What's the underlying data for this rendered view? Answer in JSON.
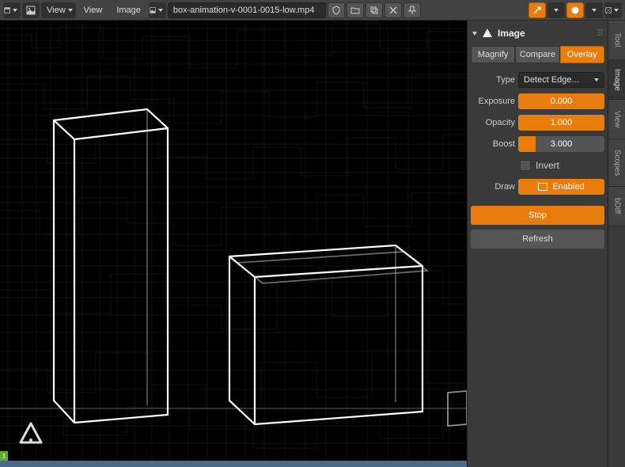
{
  "toolbar": {
    "view_menu_label": "View",
    "view_label": "View",
    "image_label": "Image",
    "file_name": "box-animation-v-0001-0015-low.mp4"
  },
  "panel": {
    "title": "Image",
    "tabs": {
      "magnify": "Magnify",
      "compare": "Compare",
      "overlay": "Overlay"
    },
    "props": {
      "type_label": "Type",
      "type_value": "Detect Edge...",
      "exposure_label": "Exposure",
      "exposure_value": "0.000",
      "opacity_label": "Opacity",
      "opacity_value": "1.000",
      "boost_label": "Boost",
      "boost_value": "3.000",
      "invert_label": "Invert",
      "draw_label": "Draw",
      "draw_value": "Enabled"
    },
    "stop_button": "Stop",
    "refresh_button": "Refresh"
  },
  "vtabs": {
    "tool": "Tool",
    "image": "Image",
    "view": "View",
    "scopes": "Scopes",
    "bdiff": "bDiff"
  },
  "status": {
    "indicator": "1"
  }
}
